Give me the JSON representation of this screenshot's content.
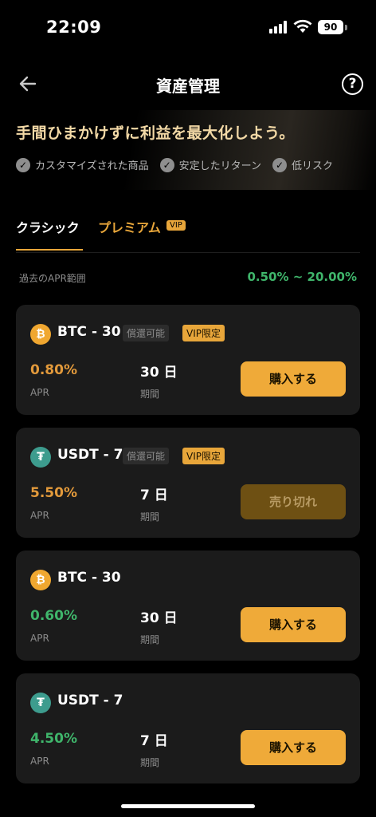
{
  "status_bar": {
    "time": "22:09",
    "battery": "90"
  },
  "nav": {
    "title": "資産管理",
    "help": "?"
  },
  "hero": {
    "headline": "手間ひまかけずに利益を最大化しよう。",
    "features": [
      "カスタマイズされた商品",
      "安定したリターン",
      "低リスク"
    ]
  },
  "tabs": {
    "classic": "クラシック",
    "premium": "プレミアム",
    "premium_badge": "VIP"
  },
  "apr_range": {
    "label": "過去のAPR範囲",
    "value": "0.50% ~ 20.00%"
  },
  "products": [
    {
      "coin": "btc",
      "coin_symbol": "₿",
      "title": "BTC - 30",
      "redeem_tag": "償還可能",
      "vip_tag": "VIP限定",
      "apr": "0.80%",
      "apr_label": "APR",
      "term": "30 日",
      "term_label": "期間",
      "action": "購入する",
      "enabled": true
    },
    {
      "coin": "usdt",
      "coin_symbol": "₮",
      "title": "USDT - 7",
      "redeem_tag": "償還可能",
      "vip_tag": "VIP限定",
      "apr": "5.50%",
      "apr_label": "APR",
      "term": "7 日",
      "term_label": "期間",
      "action": "売り切れ",
      "enabled": false
    },
    {
      "coin": "btc",
      "coin_symbol": "₿",
      "title": "BTC - 30",
      "apr": "0.60%",
      "apr_label": "APR",
      "term": "30 日",
      "term_label": "期間",
      "action": "購入する",
      "enabled": true
    },
    {
      "coin": "usdt",
      "coin_symbol": "₮",
      "title": "USDT - 7",
      "apr": "4.50%",
      "apr_label": "APR",
      "term": "7 日",
      "term_label": "期間",
      "action": "購入する",
      "enabled": true
    }
  ],
  "colors": {
    "accent": "#efaa39",
    "green": "#3fb56b",
    "orange": "#e39a3b",
    "card_bg": "#1b1b1b"
  }
}
